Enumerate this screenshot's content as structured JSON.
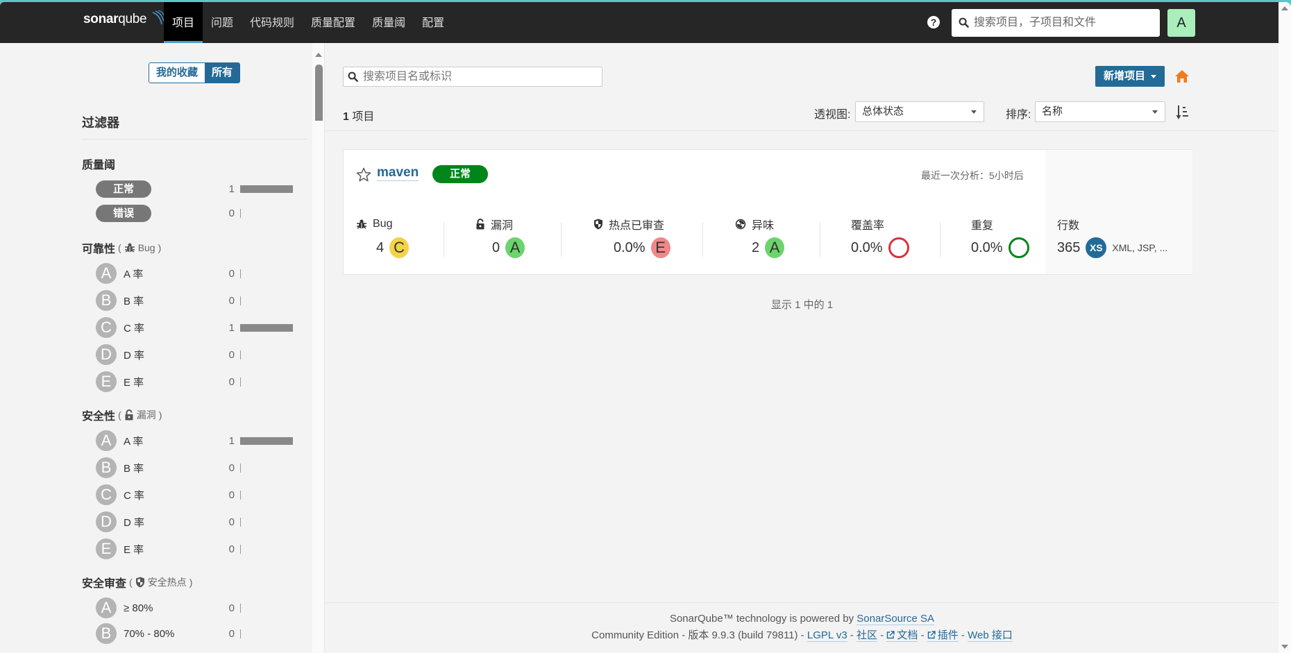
{
  "app": {
    "logo_bold": "sonar",
    "logo_light": "qube",
    "accent_color": "#236a97",
    "window_border_color": "#5ec4c4"
  },
  "navbar": {
    "items": [
      {
        "label": "项目",
        "active": true
      },
      {
        "label": "问题",
        "active": false
      },
      {
        "label": "代码规则",
        "active": false
      },
      {
        "label": "质量配置",
        "active": false
      },
      {
        "label": "质量阈",
        "active": false
      },
      {
        "label": "配置",
        "active": false
      }
    ],
    "help_icon": "question-circle-icon",
    "search_placeholder": "搜索项目，子项目和文件",
    "avatar_letter": "A"
  },
  "sidebar": {
    "toggle": {
      "favorites": "我的收藏",
      "all": "所有",
      "selected": "all"
    },
    "filter_title": "过滤器",
    "quality_gate": {
      "title": "质量阈",
      "items": [
        {
          "label": "正常",
          "count": "1",
          "fraction": 1
        },
        {
          "label": "错误",
          "count": "0",
          "fraction": 0
        }
      ]
    },
    "reliability": {
      "title": "可靠性",
      "paren_open": "(",
      "sub_icon": "bug-icon",
      "sub_label": "Bug",
      "paren_close": ")",
      "items": [
        {
          "grade": "A",
          "label": "A 率",
          "count": "0",
          "fraction": 0
        },
        {
          "grade": "B",
          "label": "B 率",
          "count": "0",
          "fraction": 0
        },
        {
          "grade": "C",
          "label": "C 率",
          "count": "1",
          "fraction": 1
        },
        {
          "grade": "D",
          "label": "D 率",
          "count": "0",
          "fraction": 0
        },
        {
          "grade": "E",
          "label": "E 率",
          "count": "0",
          "fraction": 0
        }
      ]
    },
    "security": {
      "title": "安全性",
      "paren_open": "(",
      "sub_icon": "unlock-icon",
      "sub_label": "漏洞",
      "paren_close": ")",
      "items": [
        {
          "grade": "A",
          "label": "A 率",
          "count": "1",
          "fraction": 1
        },
        {
          "grade": "B",
          "label": "B 率",
          "count": "0",
          "fraction": 0
        },
        {
          "grade": "C",
          "label": "C 率",
          "count": "0",
          "fraction": 0
        },
        {
          "grade": "D",
          "label": "D 率",
          "count": "0",
          "fraction": 0
        },
        {
          "grade": "E",
          "label": "E 率",
          "count": "0",
          "fraction": 0
        }
      ]
    },
    "security_review": {
      "title": "安全审查",
      "paren_open": "(",
      "sub_icon": "shield-icon",
      "sub_label": "安全热点",
      "paren_close": ")",
      "items": [
        {
          "grade": "A",
          "label": "≥ 80%",
          "count": "0",
          "fraction": 0
        },
        {
          "grade": "B",
          "label": "70% - 80%",
          "count": "0",
          "fraction": 0
        }
      ]
    }
  },
  "main": {
    "search_placeholder": "搜索项目名或标识",
    "count_number": "1",
    "count_label": "项目",
    "new_project_label": "新增项目",
    "perspective_label": "透视图:",
    "perspective_value": "总体状态",
    "sort_label": "排序:",
    "sort_value": "名称",
    "project": {
      "name": "maven",
      "quality_gate": "正常",
      "quality_gate_color": "#00851b",
      "last_analysis": "最近一次分析：5小时后",
      "metrics": {
        "bugs": {
          "label": "Bug",
          "value": "4",
          "grade": "C",
          "grade_color": "#f4d348"
        },
        "vulnerabilities": {
          "label": "漏洞",
          "value": "0",
          "grade": "A",
          "grade_color": "#6cd46c"
        },
        "hotspots": {
          "label": "热点已审查",
          "value": "0.0%",
          "grade": "E",
          "grade_color": "#f08789"
        },
        "code_smells": {
          "label": "异味",
          "value": "2",
          "grade": "A",
          "grade_color": "#6cd46c"
        },
        "coverage": {
          "label": "覆盖率",
          "value": "0.0%",
          "ring_color": "#d4333f"
        },
        "duplications": {
          "label": "重复",
          "value": "0.0%",
          "ring_color": "#00851b"
        },
        "lines": {
          "label": "行数",
          "value": "365",
          "size": "XS",
          "languages": "XML, JSP, ..."
        }
      }
    },
    "pagination": "显示 1 中的 1"
  },
  "footer": {
    "line1_text": "SonarQube™ technology is powered by",
    "line1_link": "SonarSource SA",
    "edition": "Community Edition - 版本 9.9.3 (build 79811) -",
    "license": "LGPL v3",
    "community": "社区",
    "docs": "文档",
    "plugins": "插件",
    "web_api": "Web 接口",
    "sep": "-"
  }
}
